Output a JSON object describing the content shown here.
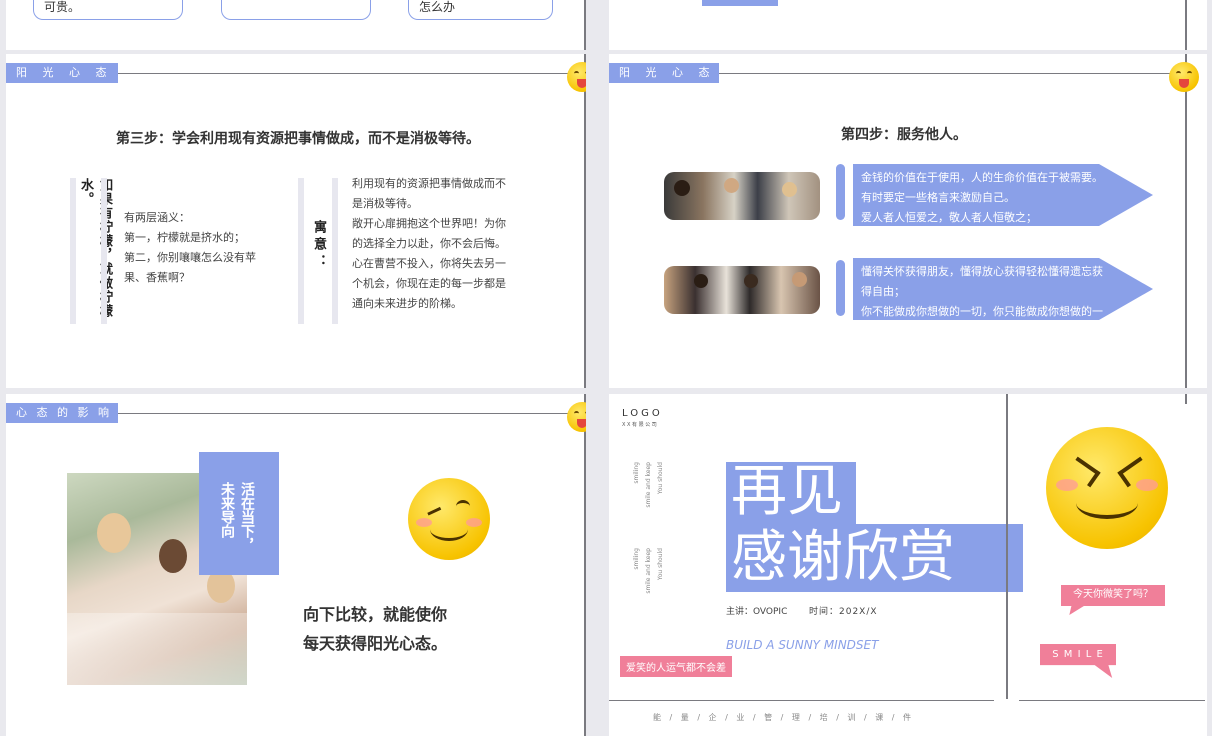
{
  "top": {
    "box1_text": "可贵。",
    "box3_text": "怎么办"
  },
  "slide3": {
    "tag": "阳 光 心 态",
    "title": "第三步：学会利用现有资源把事情做成，而不是消极等待。",
    "vertical_heading": "如果有柠檬，就做柠檬水。",
    "meaning_lines": [
      "有两层涵义：",
      "第一，柠檬就是挤水的；",
      "第二，你别嚷嚷怎么没有苹",
      "果、香蕉啊？"
    ],
    "moral_label": "寓意：",
    "moral_lines": [
      "利用现有的资源把事情做成而不",
      "是消极等待。",
      "敞开心扉拥抱这个世界吧！为你",
      "的选择全力以赴，你不会后悔。",
      "心在曹营不投入，你将失去另一",
      "个机会，你现在走的每一步都是",
      "通向未来进步的阶梯。"
    ]
  },
  "slide4": {
    "tag": "阳 光 心 态",
    "title": "第四步：服务他人。",
    "arrow1_lines": [
      "金钱的价值在于使用，人的生命价值在于被需要。",
      "有时要定一些格言来激励自己。",
      "爱人者人恒爱之，敬人者人恒敬之；"
    ],
    "arrow2_lines": [
      "懂得关怀获得朋友，懂得放心获得轻松懂得遗忘获",
      "得自由；",
      "你不能做成你想做的一切，你只能做成你想做的一"
    ]
  },
  "slide5": {
    "tag": "心 态 的 影 响",
    "vertical_label": "活在当下，未来导向",
    "text_line1": "向下比较，就能使你",
    "text_line2": "每天获得阳光心态。"
  },
  "slide6": {
    "logo": "LOGO",
    "logo_sub": "X X 有 限 公 司",
    "vt1a": "You should",
    "vt1b": "smile and keep",
    "vt1c": "smiling",
    "vt2a": "You should",
    "vt2b": "smile and keep",
    "vt2c": "smiling",
    "big1": "再见",
    "big2": "感谢欣赏",
    "presenter": "主讲：OVOPIC",
    "time": "时间：202X/X",
    "english": "BUILD A SUNNY MINDSET",
    "pink_bottom": "爱笑的人运气都不会差",
    "bubble1": "今天你微笑了吗？",
    "bubble2": "S M I L E",
    "footer": "能 / 量 / 企 / 业 / 管 / 理 / 培 / 训 / 课 / 件"
  }
}
